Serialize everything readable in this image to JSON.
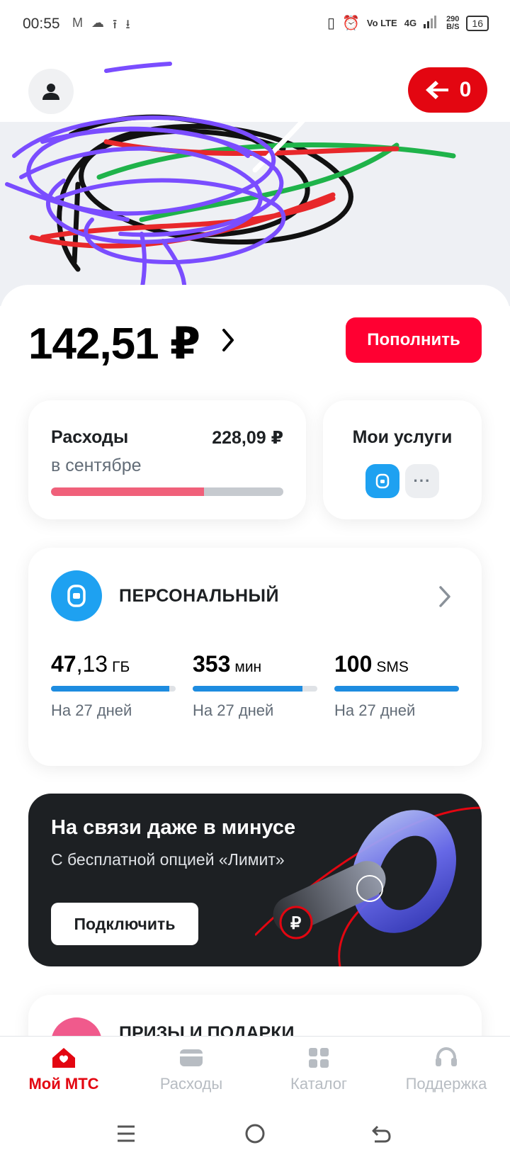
{
  "status_bar": {
    "time": "00:55",
    "network": "Vo LTE",
    "network_gen": "4G",
    "speed_value": "290",
    "speed_unit": "B/S",
    "battery": "16"
  },
  "header": {
    "cashback_count": "0"
  },
  "balance": {
    "amount": "142,51 ₽"
  },
  "topup_label": "Пополнить",
  "expenses_card": {
    "title": "Расходы",
    "amount": "228,09 ₽",
    "period": "в сентябре",
    "progress": 0.66
  },
  "services_card": {
    "title": "Мои услуги",
    "more": "···"
  },
  "tariff": {
    "name": "ПЕРСОНАЛЬНЫЙ",
    "quotas": [
      {
        "int": "47",
        "dec": ",13",
        "unit": "ГБ",
        "days": "На 27 дней",
        "progress": 0.95
      },
      {
        "int": "353",
        "dec": "",
        "unit": "мин",
        "days": "На 27 дней",
        "progress": 0.88
      },
      {
        "int": "100",
        "dec": "",
        "unit": "SMS",
        "days": "На 27 дней",
        "progress": 1.0
      }
    ]
  },
  "promo": {
    "title": "На связи даже в минусе",
    "subtitle": "С бесплатной опцией «Лимит»",
    "button": "Подключить"
  },
  "prizes": {
    "title": "ПРИЗЫ И ПОДАРКИ"
  },
  "tabs": [
    {
      "label": "Мой МТС",
      "icon": "house-icon",
      "active": true
    },
    {
      "label": "Расходы",
      "icon": "wallet-icon",
      "active": false
    },
    {
      "label": "Каталог",
      "icon": "grid-icon",
      "active": false
    },
    {
      "label": "Поддержка",
      "icon": "headset-icon",
      "active": false
    }
  ],
  "colors": {
    "brand_red": "#e30611",
    "accent_blue": "#1ea1f1",
    "expense_pink": "#f0607a"
  }
}
